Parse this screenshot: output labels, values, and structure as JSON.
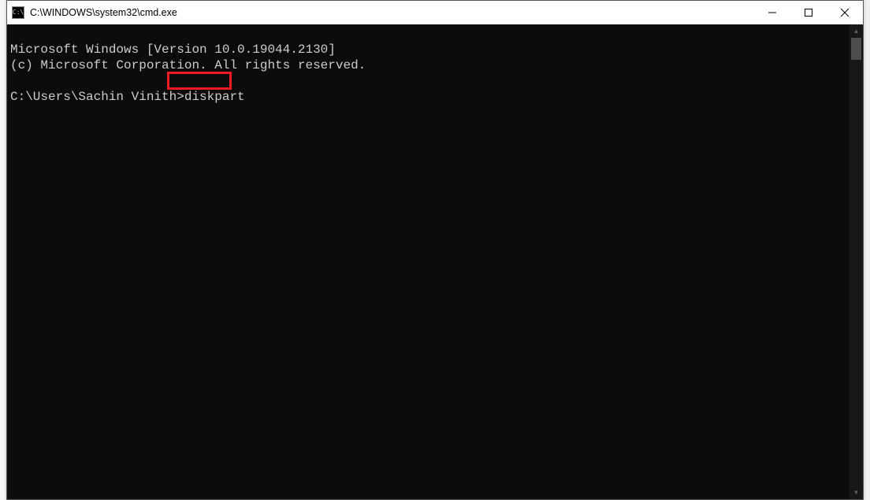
{
  "window": {
    "title": "C:\\WINDOWS\\system32\\cmd.exe"
  },
  "terminal": {
    "line1": "Microsoft Windows [Version 10.0.19044.2130]",
    "line2": "(c) Microsoft Corporation. All rights reserved.",
    "blank": "",
    "prompt": "C:\\Users\\Sachin Vinith>",
    "command": "diskpart"
  },
  "highlight": {
    "target": "diskpart",
    "color": "#ed1c24"
  },
  "icons": {
    "cmd": "C:\\",
    "minimize": "minimize",
    "maximize": "maximize",
    "close": "close",
    "scroll_up": "▲",
    "scroll_down": "▼"
  }
}
